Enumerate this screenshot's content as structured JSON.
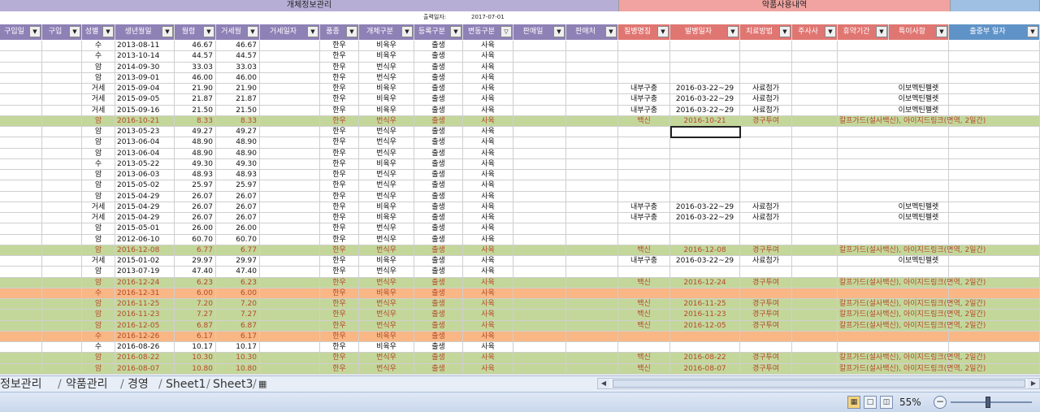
{
  "bands": {
    "left": "개체정보관리",
    "right": "약품사용내역"
  },
  "print_date": {
    "label": "출력일자:",
    "value": "2017-07-01"
  },
  "columns": [
    "구입일",
    "구입",
    "성별",
    "생년월일",
    "월령",
    "거세월",
    "거세일자",
    "품종",
    "개체구분",
    "등록구분",
    "변동구분",
    "판매일",
    "판매처",
    "질병명칭",
    "발병일자",
    "치료방법",
    "주사사",
    "휴약기간",
    "특이사항",
    "출중부 일자"
  ],
  "rows": [
    {
      "t": "w",
      "v": [
        "",
        "",
        "수",
        "2013-08-11",
        "46.67",
        "46.67",
        "",
        "한우",
        "비육우",
        "출생",
        "사육",
        "",
        "",
        "",
        "",
        "",
        "",
        "",
        "",
        ""
      ]
    },
    {
      "t": "w",
      "v": [
        "",
        "",
        "수",
        "2013-10-14",
        "44.57",
        "44.57",
        "",
        "한우",
        "비육우",
        "출생",
        "사육",
        "",
        "",
        "",
        "",
        "",
        "",
        "",
        "",
        ""
      ]
    },
    {
      "t": "w",
      "v": [
        "",
        "",
        "암",
        "2014-09-30",
        "33.03",
        "33.03",
        "",
        "한우",
        "번식우",
        "출생",
        "사육",
        "",
        "",
        "",
        "",
        "",
        "",
        "",
        "",
        ""
      ]
    },
    {
      "t": "w",
      "v": [
        "",
        "",
        "암",
        "2013-09-01",
        "46.00",
        "46.00",
        "",
        "한우",
        "번식우",
        "출생",
        "사육",
        "",
        "",
        "",
        "",
        "",
        "",
        "",
        "",
        ""
      ]
    },
    {
      "t": "w",
      "v": [
        "",
        "",
        "거세",
        "2015-09-04",
        "21.90",
        "21.90",
        "",
        "한우",
        "비육우",
        "출생",
        "사육",
        "",
        "",
        "내부구충",
        "2016-03-22~29",
        "사료첨가",
        "",
        "",
        "이보멕틴펠렛",
        ""
      ]
    },
    {
      "t": "w",
      "v": [
        "",
        "",
        "거세",
        "2015-09-05",
        "21.87",
        "21.87",
        "",
        "한우",
        "비육우",
        "출생",
        "사육",
        "",
        "",
        "내부구충",
        "2016-03-22~29",
        "사료첨가",
        "",
        "",
        "이보멕틴펠렛",
        ""
      ]
    },
    {
      "t": "w",
      "v": [
        "",
        "",
        "거세",
        "2015-09-16",
        "21.50",
        "21.50",
        "",
        "한우",
        "비육우",
        "출생",
        "사육",
        "",
        "",
        "내부구충",
        "2016-03-22~29",
        "사료첨가",
        "",
        "",
        "이보멕틴펠렛",
        ""
      ]
    },
    {
      "t": "g",
      "v": [
        "",
        "",
        "암",
        "2016-10-21",
        "8.33",
        "8.33",
        "",
        "한우",
        "번식우",
        "출생",
        "사육",
        "",
        "",
        "백신",
        "2016-10-21",
        "경구투여",
        "",
        "칼프가드(설사백신), 아이지드링크(면역, 2일간)",
        "",
        ""
      ]
    },
    {
      "t": "w",
      "v": [
        "",
        "",
        "암",
        "2013-05-23",
        "49.27",
        "49.27",
        "",
        "한우",
        "번식우",
        "출생",
        "사육",
        "",
        "",
        "",
        "",
        "",
        "",
        "",
        "",
        ""
      ]
    },
    {
      "t": "w",
      "v": [
        "",
        "",
        "암",
        "2013-06-04",
        "48.90",
        "48.90",
        "",
        "한우",
        "번식우",
        "출생",
        "사육",
        "",
        "",
        "",
        "",
        "",
        "",
        "",
        "",
        ""
      ]
    },
    {
      "t": "w",
      "v": [
        "",
        "",
        "암",
        "2013-06-04",
        "48.90",
        "48.90",
        "",
        "한우",
        "번식우",
        "출생",
        "사육",
        "",
        "",
        "",
        "",
        "",
        "",
        "",
        "",
        ""
      ]
    },
    {
      "t": "w",
      "v": [
        "",
        "",
        "수",
        "2013-05-22",
        "49.30",
        "49.30",
        "",
        "한우",
        "비육우",
        "출생",
        "사육",
        "",
        "",
        "",
        "",
        "",
        "",
        "",
        "",
        ""
      ]
    },
    {
      "t": "w",
      "v": [
        "",
        "",
        "암",
        "2013-06-03",
        "48.93",
        "48.93",
        "",
        "한우",
        "번식우",
        "출생",
        "사육",
        "",
        "",
        "",
        "",
        "",
        "",
        "",
        "",
        ""
      ]
    },
    {
      "t": "w",
      "v": [
        "",
        "",
        "암",
        "2015-05-02",
        "25.97",
        "25.97",
        "",
        "한우",
        "번식우",
        "출생",
        "사육",
        "",
        "",
        "",
        "",
        "",
        "",
        "",
        "",
        ""
      ]
    },
    {
      "t": "w",
      "v": [
        "",
        "",
        "암",
        "2015-04-29",
        "26.07",
        "26.07",
        "",
        "한우",
        "번식우",
        "출생",
        "사육",
        "",
        "",
        "",
        "",
        "",
        "",
        "",
        "",
        ""
      ]
    },
    {
      "t": "w",
      "v": [
        "",
        "",
        "거세",
        "2015-04-29",
        "26.07",
        "26.07",
        "",
        "한우",
        "비육우",
        "출생",
        "사육",
        "",
        "",
        "내부구충",
        "2016-03-22~29",
        "사료첨가",
        "",
        "",
        "이보멕틴펠렛",
        ""
      ]
    },
    {
      "t": "w",
      "v": [
        "",
        "",
        "거세",
        "2015-04-29",
        "26.07",
        "26.07",
        "",
        "한우",
        "비육우",
        "출생",
        "사육",
        "",
        "",
        "내부구충",
        "2016-03-22~29",
        "사료첨가",
        "",
        "",
        "이보멕틴펠렛",
        ""
      ]
    },
    {
      "t": "w",
      "v": [
        "",
        "",
        "암",
        "2015-05-01",
        "26.00",
        "26.00",
        "",
        "한우",
        "번식우",
        "출생",
        "사육",
        "",
        "",
        "",
        "",
        "",
        "",
        "",
        "",
        ""
      ]
    },
    {
      "t": "w",
      "v": [
        "",
        "",
        "암",
        "2012-06-10",
        "60.70",
        "60.70",
        "",
        "한우",
        "번식우",
        "출생",
        "사육",
        "",
        "",
        "",
        "",
        "",
        "",
        "",
        "",
        ""
      ]
    },
    {
      "t": "g",
      "v": [
        "",
        "",
        "암",
        "2016-12-08",
        "6.77",
        "6.77",
        "",
        "한우",
        "번식우",
        "출생",
        "사육",
        "",
        "",
        "백신",
        "2016-12-08",
        "경구투여",
        "",
        "칼프가드(설사백신), 아이지드링크(면역, 2일간)",
        "",
        ""
      ]
    },
    {
      "t": "w",
      "v": [
        "",
        "",
        "거세",
        "2015-01-02",
        "29.97",
        "29.97",
        "",
        "한우",
        "비육우",
        "출생",
        "사육",
        "",
        "",
        "내부구충",
        "2016-03-22~29",
        "사료첨가",
        "",
        "",
        "이보멕틴펠렛",
        ""
      ]
    },
    {
      "t": "w",
      "v": [
        "",
        "",
        "암",
        "2013-07-19",
        "47.40",
        "47.40",
        "",
        "한우",
        "번식우",
        "출생",
        "사육",
        "",
        "",
        "",
        "",
        "",
        "",
        "",
        "",
        ""
      ]
    },
    {
      "t": "g",
      "v": [
        "",
        "",
        "암",
        "2016-12-24",
        "6.23",
        "6.23",
        "",
        "한우",
        "번식우",
        "출생",
        "사육",
        "",
        "",
        "백신",
        "2016-12-24",
        "경구투여",
        "",
        "칼프가드(설사백신), 아이지드링크(면역, 2일간)",
        "",
        ""
      ]
    },
    {
      "t": "o",
      "v": [
        "",
        "",
        "수",
        "2016-12-31",
        "6.00",
        "6.00",
        "",
        "한우",
        "비육우",
        "출생",
        "사육",
        "",
        "",
        "",
        "",
        "",
        "",
        "",
        "",
        ""
      ]
    },
    {
      "t": "g",
      "v": [
        "",
        "",
        "암",
        "2016-11-25",
        "7.20",
        "7.20",
        "",
        "한우",
        "번식우",
        "출생",
        "사육",
        "",
        "",
        "백신",
        "2016-11-25",
        "경구투여",
        "",
        "칼프가드(설사백신), 아이지드링크(면역, 2일간)",
        "",
        ""
      ]
    },
    {
      "t": "g",
      "v": [
        "",
        "",
        "암",
        "2016-11-23",
        "7.27",
        "7.27",
        "",
        "한우",
        "번식우",
        "출생",
        "사육",
        "",
        "",
        "백신",
        "2016-11-23",
        "경구투여",
        "",
        "칼프가드(설사백신), 아이지드링크(면역, 2일간)",
        "",
        ""
      ]
    },
    {
      "t": "g",
      "v": [
        "",
        "",
        "암",
        "2016-12-05",
        "6.87",
        "6.87",
        "",
        "한우",
        "번식우",
        "출생",
        "사육",
        "",
        "",
        "백신",
        "2016-12-05",
        "경구투여",
        "",
        "칼프가드(설사백신), 아이지드링크(면역, 2일간)",
        "",
        ""
      ]
    },
    {
      "t": "o",
      "v": [
        "",
        "",
        "수",
        "2016-12-26",
        "6.17",
        "6.17",
        "",
        "한우",
        "비육우",
        "출생",
        "사육",
        "",
        "",
        "",
        "",
        "",
        "",
        "",
        "",
        ""
      ]
    },
    {
      "t": "w",
      "v": [
        "",
        "",
        "수",
        "2016-08-26",
        "10.17",
        "10.17",
        "",
        "한우",
        "비육우",
        "출생",
        "사육",
        "",
        "",
        "",
        "",
        "",
        "",
        "",
        "",
        ""
      ]
    },
    {
      "t": "g",
      "v": [
        "",
        "",
        "암",
        "2016-08-22",
        "10.30",
        "10.30",
        "",
        "한우",
        "번식우",
        "출생",
        "사육",
        "",
        "",
        "백신",
        "2016-08-22",
        "경구투여",
        "",
        "칼프가드(설사백신), 아이지드링크(면역, 2일간)",
        "",
        ""
      ]
    },
    {
      "t": "g",
      "v": [
        "",
        "",
        "암",
        "2016-08-07",
        "10.80",
        "10.80",
        "",
        "한우",
        "번식우",
        "출생",
        "사육",
        "",
        "",
        "백신",
        "2016-08-07",
        "경구투여",
        "",
        "칼프가드(설사백신), 아이지드링크(면역, 2일간)",
        "",
        ""
      ]
    }
  ],
  "tabs": [
    "정보관리",
    "약품관리",
    "경영",
    "Sheet1",
    "Sheet3"
  ],
  "zoom": "55%",
  "colors": {
    "purple": "#8e81b6",
    "red": "#e07672",
    "blue": "#5f93c7",
    "green": "#c4d79b",
    "orange": "#f8b785"
  }
}
